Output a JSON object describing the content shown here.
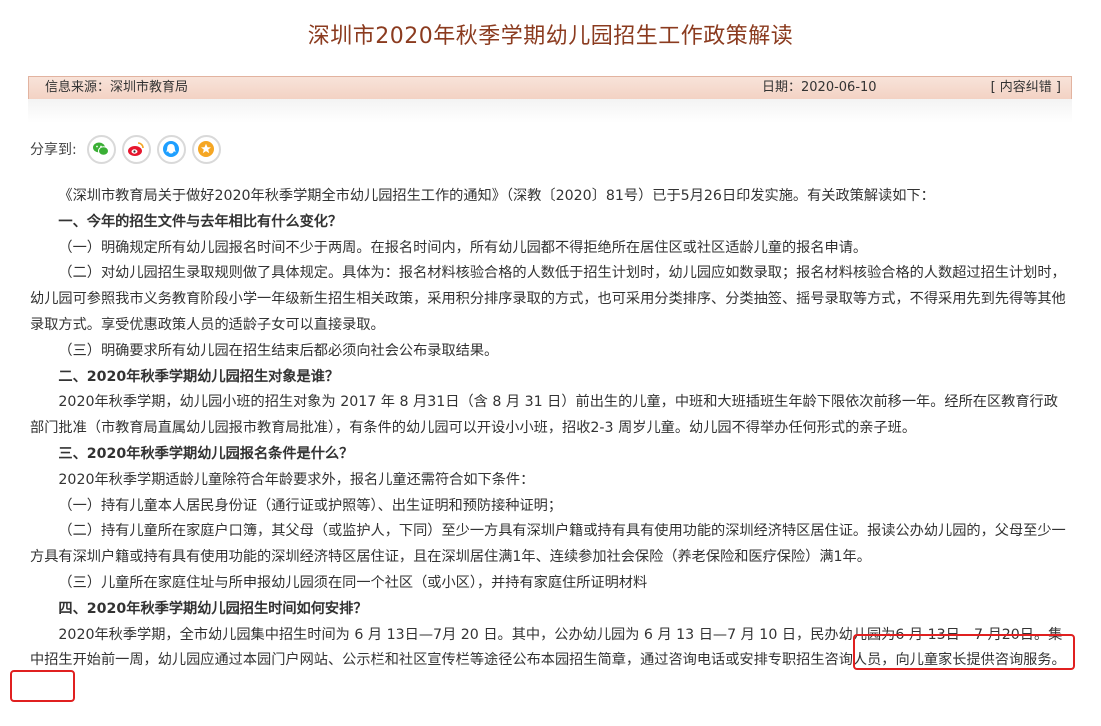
{
  "title": "深圳市2020年秋季学期幼儿园招生工作政策解读",
  "info": {
    "source": "信息来源：深圳市教育局",
    "date": "日期：2020-06-10",
    "correction": "[ 内容纠错 ]"
  },
  "share": {
    "label": "分享到:",
    "icons": [
      "wechat-icon",
      "weibo-icon",
      "qq-icon",
      "favorite-icon"
    ]
  },
  "colors": {
    "title": "#8b3b1f",
    "infobar_bg": "#f3d2c4",
    "wechat": "#3aaf35",
    "weibo": "#e6162d",
    "qq": "#1e9fff",
    "favorite": "#f5a623",
    "highlight": "#e02020"
  },
  "content": {
    "p1": "《深圳市教育局关于做好2020年秋季学期全市幼儿园招生工作的通知》（深教〔2020〕81号）已于5月26日印发实施。有关政策解读如下：",
    "h1": "一、今年的招生文件与去年相比有什么变化？",
    "p2": "（一）明确规定所有幼儿园报名时间不少于两周。在报名时间内，所有幼儿园都不得拒绝所在居住区或社区适龄儿童的报名申请。",
    "p3": "（二）对幼儿园招生录取规则做了具体规定。具体为：报名材料核验合格的人数低于招生计划时，幼儿园应如数录取；报名材料核验合格的人数超过招生计划时，幼儿园可参照我市义务教育阶段小学一年级新生招生相关政策，采用积分排序录取的方式，也可采用分类排序、分类抽签、摇号录取等方式，不得采用先到先得等其他录取方式。享受优惠政策人员的适龄子女可以直接录取。",
    "p4": "（三）明确要求所有幼儿园在招生结束后都必须向社会公布录取结果。",
    "h2": "二、2020年秋季学期幼儿园招生对象是谁？",
    "p5": "2020年秋季学期，幼儿园小班的招生对象为 2017 年 8 月31日（含 8 月 31 日）前出生的儿童，中班和大班插班生年龄下限依次前移一年。经所在区教育行政部门批准（市教育局直属幼儿园报市教育局批准），有条件的幼儿园可以开设小小班，招收2-3 周岁儿童。幼儿园不得举办任何形式的亲子班。",
    "h3": "三、2020年秋季学期幼儿园报名条件是什么？",
    "p6": "2020年秋季学期适龄儿童除符合年龄要求外，报名儿童还需符合如下条件：",
    "p7": "（一）持有儿童本人居民身份证（通行证或护照等）、出生证明和预防接种证明；",
    "p8": "（二）持有儿童所在家庭户口簿，其父母（或监护人，下同）至少一方具有深圳户籍或持有具有使用功能的深圳经济特区居住证。报读公办幼儿园的，父母至少一方具有深圳户籍或持有具有使用功能的深圳经济特区居住证，且在深圳居住满1年、连续参加社会保险（养老保险和医疗保险）满1年。",
    "p9": "（三）儿童所在家庭住址与所申报幼儿园须在同一个社区（或小区），并持有家庭住所证明材料",
    "h4": "四、2020年秋季学期幼儿园招生时间如何安排？",
    "p10": "2020年秋季学期，全市幼儿园集中招生时间为 6 月 13日—7月 20 日。其中，公办幼儿园为 6 月 13 日—7 月 10 日，民办幼儿园为6 月 13日—7 月20日。集中招生开始前一周，幼儿园应通过本园门户网站、公示栏和社区宣传栏等途径公布本园招生简章，通过咨询电话或安排专职招生咨询人员，向儿童家长提供咨询服务。"
  }
}
